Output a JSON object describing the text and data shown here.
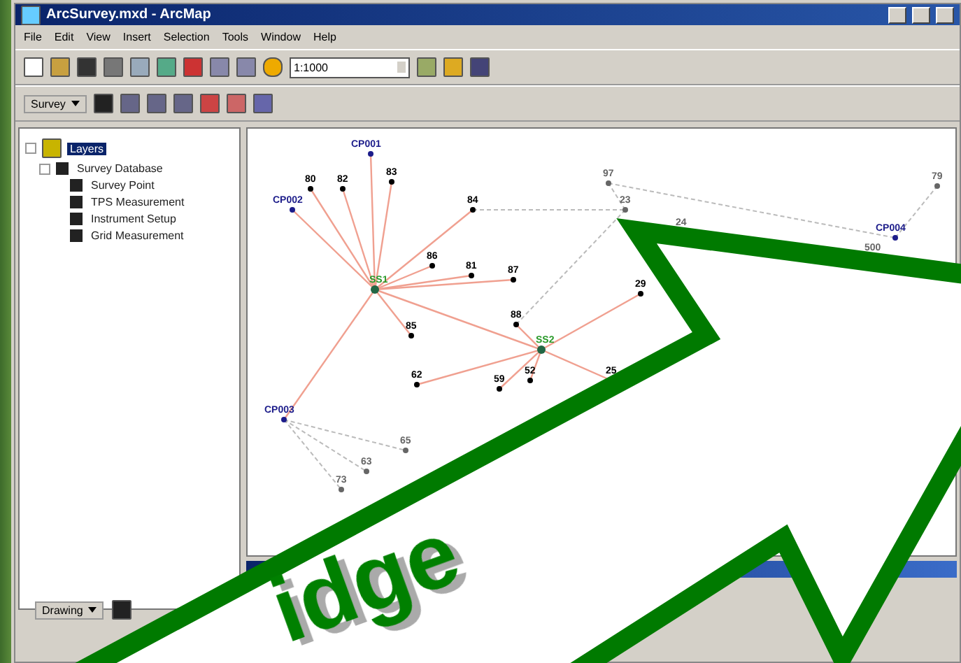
{
  "window": {
    "title": "ArcSurvey.mxd - ArcMap"
  },
  "menu": [
    "File",
    "Edit",
    "View",
    "Insert",
    "Selection",
    "Tools",
    "Window",
    "Help"
  ],
  "standard_toolbar": {
    "scale": "1:1000"
  },
  "survey_toolbar": {
    "label": "Survey"
  },
  "toc": {
    "label": "Layers",
    "selected": true,
    "expanded": true,
    "children": [
      {
        "label": "Survey Database",
        "checked": true,
        "expanded": true,
        "children": [
          {
            "label": "Survey Point",
            "checked": true
          },
          {
            "label": "TPS Measurement",
            "checked": true
          },
          {
            "label": "Instrument Setup",
            "checked": true
          },
          {
            "label": "Grid Measurement",
            "checked": true
          }
        ]
      }
    ]
  },
  "map": {
    "points": [
      {
        "label": "CP001",
        "kind": "control"
      },
      {
        "label": "CP002",
        "kind": "control"
      },
      {
        "label": "SS1",
        "kind": "station"
      },
      {
        "label": "80",
        "kind": "point"
      },
      {
        "label": "82",
        "kind": "point"
      },
      {
        "label": "83",
        "kind": "point"
      },
      {
        "label": "84",
        "kind": "point"
      },
      {
        "label": "86",
        "kind": "point"
      },
      {
        "label": "81",
        "kind": "point"
      },
      {
        "label": "87",
        "kind": "point"
      },
      {
        "label": "88",
        "kind": "point"
      },
      {
        "label": "85",
        "kind": "point"
      },
      {
        "label": "62",
        "kind": "point"
      },
      {
        "label": "SS2",
        "kind": "station"
      },
      {
        "label": "52",
        "kind": "point"
      },
      {
        "label": "59",
        "kind": "point"
      },
      {
        "label": "29",
        "kind": "point"
      },
      {
        "label": "25",
        "kind": "point"
      },
      {
        "label": "97",
        "kind": "grid"
      },
      {
        "label": "79",
        "kind": "grid"
      },
      {
        "label": "CP004",
        "kind": "control"
      },
      {
        "label": "500",
        "kind": "grid"
      },
      {
        "label": "23",
        "kind": "grid"
      },
      {
        "label": "24",
        "kind": "grid"
      },
      {
        "label": "CP003",
        "kind": "control"
      },
      {
        "label": "65",
        "kind": "grid"
      },
      {
        "label": "63",
        "kind": "grid"
      },
      {
        "label": "73",
        "kind": "grid"
      }
    ]
  },
  "drawing_toolbar": {
    "label": "Drawing"
  },
  "overlay": {
    "text": "idge"
  }
}
